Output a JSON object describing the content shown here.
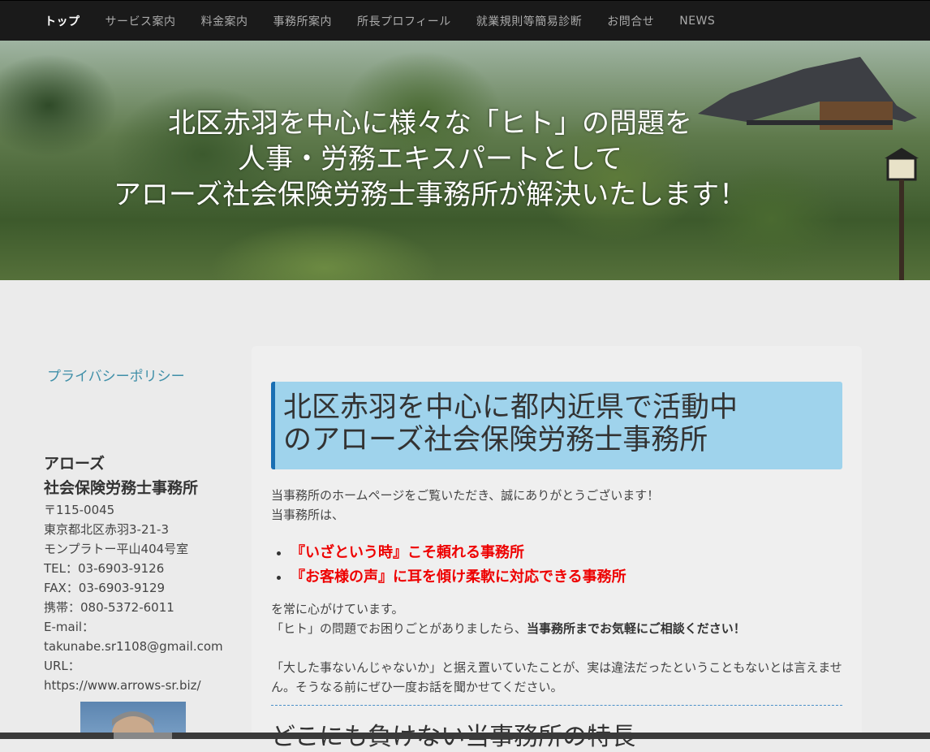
{
  "nav": {
    "items": [
      {
        "label": "トップ",
        "active": true
      },
      {
        "label": "サービス案内"
      },
      {
        "label": "料金案内"
      },
      {
        "label": "事務所案内"
      },
      {
        "label": "所長プロフィール"
      },
      {
        "label": "就業規則等簡易診断"
      },
      {
        "label": "お問合せ"
      },
      {
        "label": "NEWS"
      }
    ]
  },
  "hero": {
    "line1": "北区赤羽を中心に様々な「ヒト」の問題を",
    "line2": "人事・労務エキスパートとして",
    "line3": "アローズ社会保険労務士事務所が解決いたします！"
  },
  "sidebar": {
    "privacy_link": "プライバシーポリシー",
    "office_name_1": "アローズ",
    "office_name_2": "社会保険労務士事務所",
    "postal": "〒115-0045",
    "address_1": "東京都北区赤羽3-21-3",
    "address_2": "モンプラトー平山404号室",
    "tel": "TEL：03-6903-9126",
    "fax": "FAX：03-6903-9129",
    "mobile": "携帯：080-5372-6011",
    "email_label": "E-mail：",
    "email": "takunabe.sr1108@gmail.com",
    "url_label": "URL：",
    "url": "https://www.arrows-sr.biz/"
  },
  "main": {
    "heading_1": "北区赤羽を中心に都内近県で活動中",
    "heading_2": "のアローズ社会保険労務士事務所",
    "intro_1": "当事務所のホームページをご覧いただき、誠にありがとうございます！",
    "intro_2": "当事務所は、",
    "bullets": [
      "『いざという時』こそ頼れる事務所",
      "『お客様の声』に耳を傾け柔軟に対応できる事務所"
    ],
    "body_1": "を常に心がけています。",
    "body_2_prefix": "「ヒト」の問題でお困りごとがありましたら、",
    "body_2_bold": "当事務所までお気軽にご相談ください！",
    "body_3": "「大した事ないんじゃないか」と据え置いていたことが、実は違法だったということもないとは言えません。そうなる前にぜひ一度お話を聞かせてください。",
    "next_heading": "どこにも負けない当事務所の特長"
  },
  "colors": {
    "nav_bg": "#1a1a1a",
    "heading_bg": "#9fd3ec",
    "heading_accent": "#1a6fb3",
    "emphasis_red": "#e00000",
    "link": "#3f8fa8"
  }
}
